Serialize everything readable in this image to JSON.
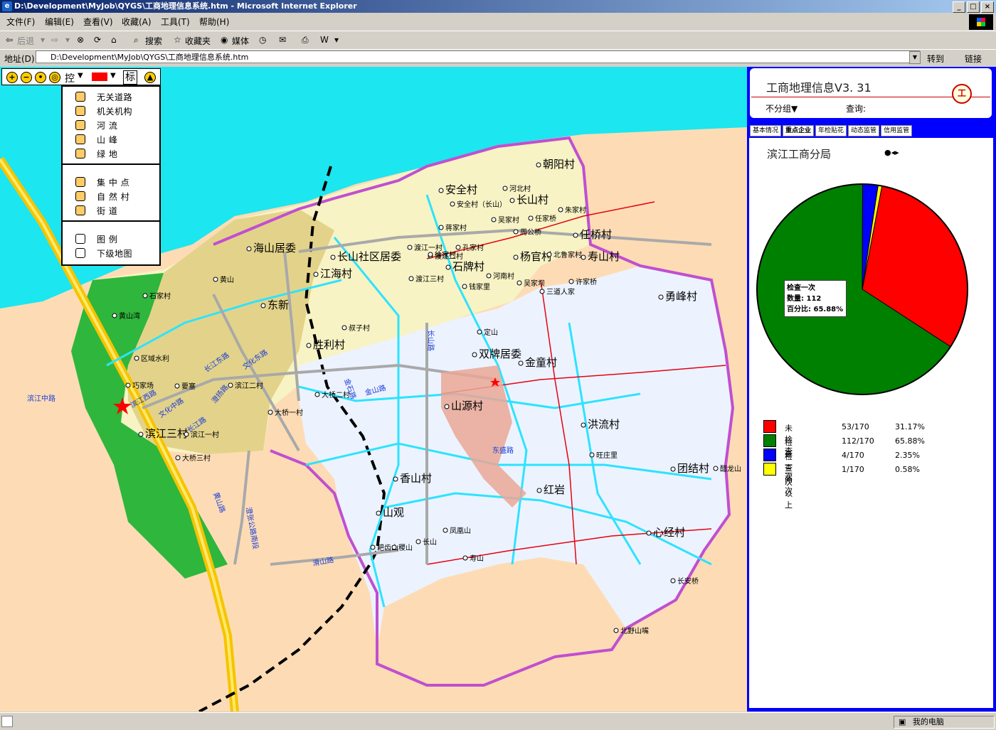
{
  "window": {
    "title": "D:\\Development\\MyJob\\QYGS\\工商地理信息系统.htm - Microsoft Internet Explorer"
  },
  "menu": [
    "文件(F)",
    "编辑(E)",
    "查看(V)",
    "收藏(A)",
    "工具(T)",
    "帮助(H)"
  ],
  "toolbar": {
    "back": "后退",
    "search": "搜索",
    "favorites": "收藏夹",
    "media": "媒体"
  },
  "address": {
    "label": "地址(D)",
    "value": "D:\\Development\\MyJob\\QYGS\\工商地理信息系统.htm",
    "go": "转到",
    "links": "链接"
  },
  "status": {
    "zone": "我的电脑"
  },
  "map": {
    "controls": {
      "pan_label": "控",
      "mark_label": "标"
    },
    "layers": [
      "无关道路",
      "机关机构",
      "河    流",
      "山    峰",
      "绿    地",
      "集 中 点",
      "自 然 村",
      "街    道",
      "图    例",
      "下级地图"
    ],
    "places": [
      "安全村",
      "长山村",
      "河北村",
      "安全村（长山）",
      "吴家村",
      "任家桥",
      "朱家村",
      "周公桥",
      "任桥村",
      "蒋家村",
      "渡江一村",
      "渡江二村",
      "孔家村",
      "徐家村",
      "长山社区居委",
      "海山居委",
      "江海村",
      "东新",
      "石牌村",
      "杨官村",
      "北鲁家村",
      "钱家里",
      "渡江三村",
      "河南村",
      "吴家坝",
      "三道人家",
      "许家桥",
      "叔子村",
      "胜利村",
      "石家村",
      "黄山湾",
      "黄山",
      "区域水利",
      "巧家场",
      "要塞",
      "滨江二村",
      "滨江三村",
      "滨江一村",
      "大桥三村",
      "大桥一村",
      "大桥二村",
      "双牌居委",
      "金童村",
      "勇峰村",
      "山源村",
      "香山村",
      "山观",
      "红岩",
      "团结村",
      "心经村",
      "洪流村",
      "朝阳村",
      "寿山村",
      "长山",
      "凤凰山",
      "长安桥",
      "北野山嘴",
      "旺庄里",
      "定山",
      "寿山",
      "醋龙山",
      "耙齿山",
      "稷山"
    ],
    "roads": [
      "滨江中路",
      "文化中路",
      "滨江西路",
      "长江路",
      "文化东路",
      "长江东路",
      "澄扬路",
      "金山路",
      "金石路",
      "长山路",
      "东盛路",
      "滑山路",
      "黄山路",
      "澄张公路南段"
    ]
  },
  "panel": {
    "title": "工商地理信息V3. 31",
    "group": "不分组▼",
    "query": "查询:",
    "tabs": [
      "基本情况",
      "重点企业",
      "年检贴花",
      "动态监管",
      "信用监管"
    ],
    "branch": "滨江工商分局",
    "tooltip": {
      "line1": "检查一次",
      "line2": "数量: 112",
      "line3": "百分比: 65.88%"
    }
  },
  "chart_data": {
    "type": "pie",
    "total": 170,
    "series": [
      {
        "name": "未检查",
        "count": "53/170",
        "value": 53,
        "percent": "31.17%",
        "color": "#ff0000"
      },
      {
        "name": "检查一次",
        "count": "112/170",
        "value": 112,
        "percent": "65.88%",
        "color": "#008000"
      },
      {
        "name": "检查两次",
        "count": "4/170",
        "value": 4,
        "percent": "2.35%",
        "color": "#0000ff"
      },
      {
        "name": "二次以上",
        "count": "1/170",
        "value": 1,
        "percent": "0.58%",
        "color": "#ffff00"
      }
    ]
  }
}
